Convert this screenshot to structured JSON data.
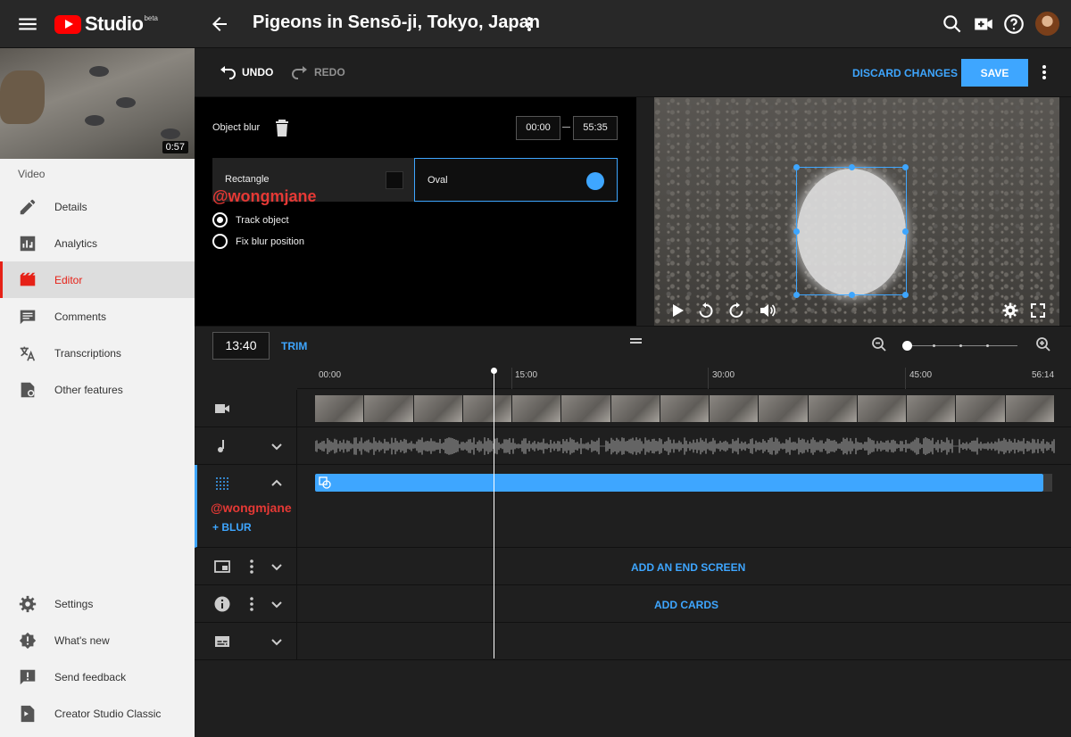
{
  "header": {
    "brand": "Studio",
    "brand_badge": "beta",
    "title": "Pigeons in Sensō-ji, Tokyo, Japan"
  },
  "sidebar": {
    "thumbnail_duration": "0:57",
    "section_label": "Video",
    "items": [
      {
        "label": "Details",
        "icon": "pencil-icon"
      },
      {
        "label": "Analytics",
        "icon": "analytics-icon"
      },
      {
        "label": "Editor",
        "icon": "editor-icon",
        "active": true
      },
      {
        "label": "Comments",
        "icon": "comments-icon"
      },
      {
        "label": "Transcriptions",
        "icon": "translate-icon"
      },
      {
        "label": "Other features",
        "icon": "other-features-icon"
      }
    ],
    "bottom_items": [
      {
        "label": "Settings",
        "icon": "gear-icon"
      },
      {
        "label": "What's new",
        "icon": "whats-new-icon"
      },
      {
        "label": "Send feedback",
        "icon": "feedback-icon"
      },
      {
        "label": "Creator Studio Classic",
        "icon": "classic-icon"
      }
    ]
  },
  "toolbar": {
    "undo": "UNDO",
    "redo": "REDO",
    "discard": "DISCARD CHANGES",
    "save": "SAVE"
  },
  "blur_panel": {
    "title": "Object blur",
    "start_time": "00:00",
    "end_time": "55:35",
    "shape_rectangle": "Rectangle",
    "shape_oval": "Oval",
    "selected_shape": "Oval",
    "option_track": "Track object",
    "option_fix": "Fix blur position",
    "selected_option": "Track object",
    "watermark": "@wongmjane"
  },
  "timeline": {
    "current_time": "13:40",
    "trim": "TRIM",
    "ruler": [
      "00:00",
      "15:00",
      "30:00",
      "45:00",
      "56:14"
    ],
    "add_blur": "+ BLUR",
    "watermark": "@wongmjane",
    "add_end_screen": "ADD AN END SCREEN",
    "add_cards": "ADD CARDS"
  },
  "colors": {
    "accent": "#3ea6ff",
    "active_nav": "#e62117",
    "watermark": "#e53935"
  }
}
